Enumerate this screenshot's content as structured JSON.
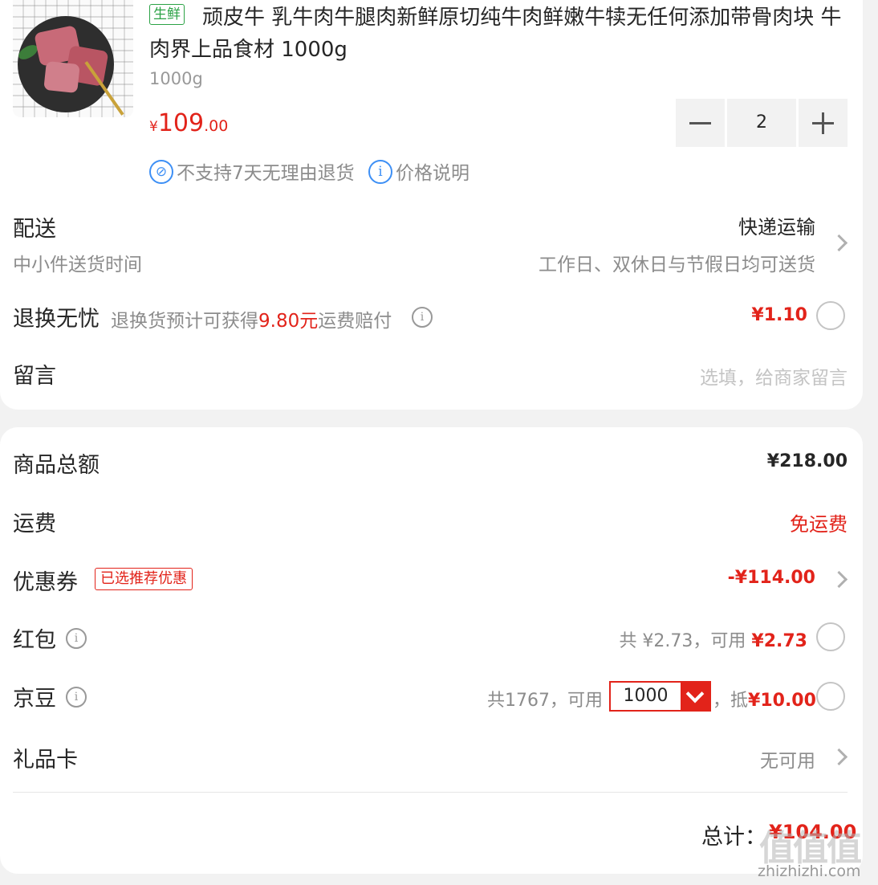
{
  "product": {
    "tag": "生鲜",
    "title": "顽皮牛 乳牛肉牛腿肉新鲜原切纯牛肉鲜嫩牛犊无任何添加带骨肉块 牛肉界上品食材 1000g",
    "spec": "1000g",
    "price_symbol": "¥",
    "price_int": "109",
    "price_dec": ".00",
    "quantity": "2",
    "no_return_text": "不支持7天无理由退货",
    "price_info_text": "价格说明"
  },
  "delivery": {
    "label": "配送",
    "method": "快递运输",
    "time_label": "中小件送货时间",
    "time_value": "工作日、双休日与节假日均可送货"
  },
  "return_worry_free": {
    "label": "退换无忧",
    "desc_prefix": "退换货预计可获得",
    "amount": "9.80元",
    "desc_suffix": "运费赔付",
    "price": "¥1.10"
  },
  "message": {
    "label": "留言",
    "placeholder": "选填，给商家留言"
  },
  "summary": {
    "goods_total_label": "商品总额",
    "goods_total": "¥218.00",
    "shipping_label": "运费",
    "shipping_value": "免运费",
    "coupon_label": "优惠券",
    "coupon_badge": "已选推荐优惠",
    "coupon_value": "-¥114.00",
    "redpacket_label": "红包",
    "redpacket_total": "共 ¥2.73，可用 ",
    "redpacket_usable": "¥2.73",
    "jingdou_label": "京豆",
    "jingdou_total": "共1767，可用",
    "jingdou_selected": "1000",
    "jingdou_deduct_prefix": "，抵",
    "jingdou_deduct": "¥10.00",
    "giftcard_label": "礼品卡",
    "giftcard_value": "无可用",
    "total_label": "总计：",
    "total_value": "¥104.00"
  },
  "watermark": {
    "text": "值值值",
    "url": "zhizhizhi.com"
  },
  "colors": {
    "accent_red": "#e2231a",
    "fresh_green": "#2ba245",
    "info_blue": "#3d8ff5"
  }
}
